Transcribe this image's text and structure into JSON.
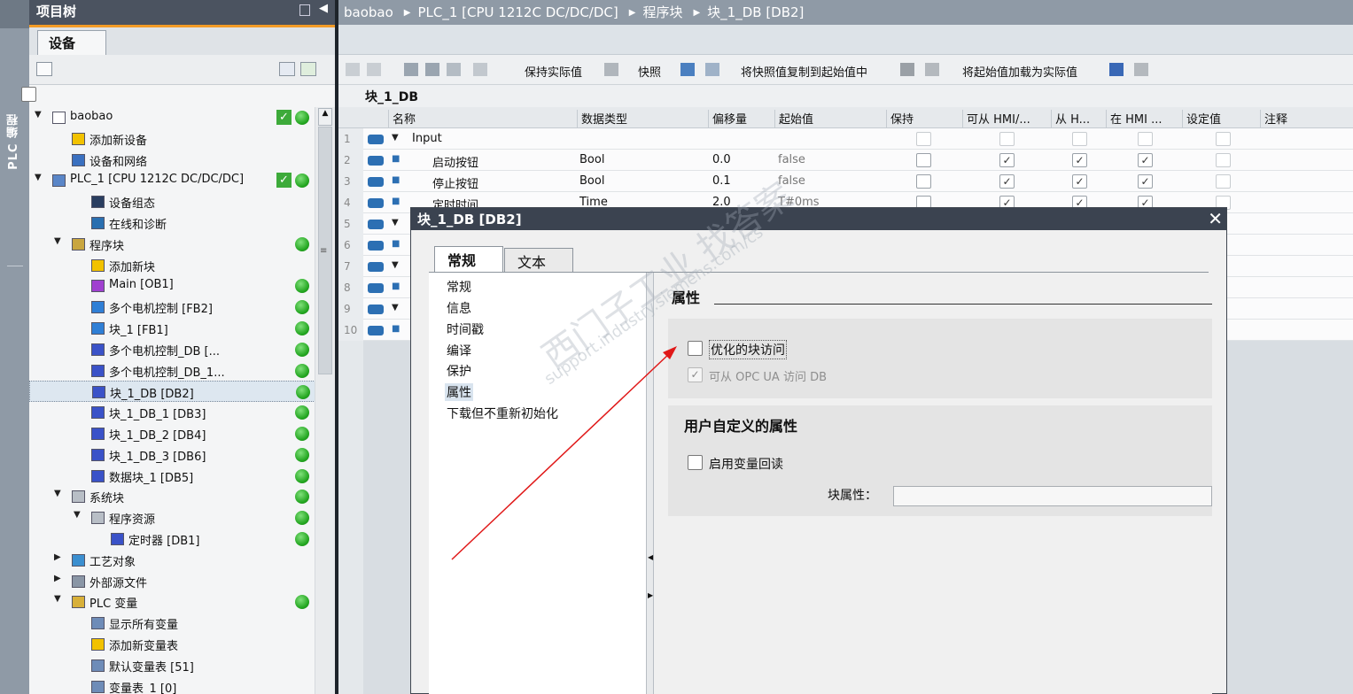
{
  "left_strip": {
    "label": "PLC 编程"
  },
  "project_tree": {
    "title": "项目树",
    "tab": "设备",
    "items": [
      {
        "label": "baobao",
        "status": "ok+online"
      },
      {
        "label": "添加新设备"
      },
      {
        "label": "设备和网络"
      },
      {
        "label": "PLC_1 [CPU 1212C DC/DC/DC]",
        "status": "ok+online"
      },
      {
        "label": "设备组态"
      },
      {
        "label": "在线和诊断"
      },
      {
        "label": "程序块",
        "status": "online"
      },
      {
        "label": "添加新块"
      },
      {
        "label": "Main [OB1]",
        "status": "online"
      },
      {
        "label": "多个电机控制 [FB2]",
        "status": "online"
      },
      {
        "label": "块_1 [FB1]",
        "status": "online"
      },
      {
        "label": "多个电机控制_DB [...",
        "status": "online"
      },
      {
        "label": "多个电机控制_DB_1...",
        "status": "online"
      },
      {
        "label": "块_1_DB [DB2]",
        "status": "online",
        "selected": true
      },
      {
        "label": "块_1_DB_1 [DB3]",
        "status": "online"
      },
      {
        "label": "块_1_DB_2 [DB4]",
        "status": "online"
      },
      {
        "label": "块_1_DB_3 [DB6]",
        "status": "online"
      },
      {
        "label": "数据块_1 [DB5]",
        "status": "online"
      },
      {
        "label": "系统块",
        "status": "online"
      },
      {
        "label": "程序资源",
        "status": "online"
      },
      {
        "label": "定时器 [DB1]",
        "status": "online"
      },
      {
        "label": "工艺对象"
      },
      {
        "label": "外部源文件"
      },
      {
        "label": "PLC 变量",
        "status": "online"
      },
      {
        "label": "显示所有变量"
      },
      {
        "label": "添加新变量表"
      },
      {
        "label": "默认变量表 [51]"
      },
      {
        "label": "变量表_1 [0]"
      }
    ]
  },
  "breadcrumb": [
    "baobao",
    "PLC_1 [CPU 1212C DC/DC/DC]",
    "程序块",
    "块_1_DB [DB2]"
  ],
  "toolbar": {
    "keep_actual": "保持实际值",
    "snapshot": "快照",
    "copy_snapshot": "将快照值复制到起始值中",
    "load_start": "将起始值加载为实际值"
  },
  "db_title": "块_1_DB",
  "table": {
    "headers": [
      "名称",
      "数据类型",
      "偏移量",
      "起始值",
      "保持",
      "可从 HMI/...",
      "从 H...",
      "在 HMI ...",
      "设定值",
      "注释"
    ],
    "rows": [
      {
        "num": "1",
        "name": "Input",
        "type": "",
        "offset": "",
        "start": "",
        "expand": "▼",
        "checks": [
          false,
          false,
          false,
          false,
          false
        ]
      },
      {
        "num": "2",
        "name": "启动按钮",
        "type": "Bool",
        "offset": "0.0",
        "start": "false",
        "expand": "■",
        "checks": [
          false,
          true,
          true,
          true,
          false
        ]
      },
      {
        "num": "3",
        "name": "停止按钮",
        "type": "Bool",
        "offset": "0.1",
        "start": "false",
        "expand": "■",
        "checks": [
          false,
          true,
          true,
          true,
          false
        ]
      },
      {
        "num": "4",
        "name": "定时时间",
        "type": "Time",
        "offset": "2.0",
        "start": "T#0ms",
        "expand": "■",
        "checks": [
          false,
          true,
          true,
          true,
          false
        ]
      },
      {
        "num": "5",
        "name": "",
        "type": "",
        "offset": "",
        "start": "",
        "expand": "▼",
        "checks": []
      },
      {
        "num": "6",
        "name": "",
        "type": "",
        "offset": "",
        "start": "",
        "expand": "■",
        "checks": []
      },
      {
        "num": "7",
        "name": "",
        "type": "",
        "offset": "",
        "start": "",
        "expand": "▼",
        "checks": []
      },
      {
        "num": "8",
        "name": "",
        "type": "",
        "offset": "",
        "start": "",
        "expand": "■",
        "checks": []
      },
      {
        "num": "9",
        "name": "",
        "type": "",
        "offset": "",
        "start": "",
        "expand": "▼",
        "checks": []
      },
      {
        "num": "10",
        "name": "",
        "type": "",
        "offset": "",
        "start": "",
        "expand": "■",
        "checks": []
      }
    ]
  },
  "dialog": {
    "title": "块_1_DB [DB2]",
    "close": "✕",
    "tabs": [
      "常规",
      "文本"
    ],
    "nav": [
      "常规",
      "信息",
      "时间戳",
      "编译",
      "保护",
      "属性",
      "下载但不重新初始化"
    ],
    "section_title": "属性",
    "optimized": {
      "label": "优化的块访问",
      "checked": false
    },
    "opcua": {
      "label": "可从 OPC UA 访问 DB",
      "checked": true
    },
    "user_section": "用户自定义的属性",
    "readback": {
      "label": "启用变量回读",
      "checked": false
    },
    "block_attr_label": "块属性："
  },
  "watermark": {
    "main": "西门子工业 找答案",
    "sub": "support.industry.siemens.com/cs"
  },
  "colors": {
    "accent_orange": "#f39b26",
    "status_green": "#3daa3a",
    "title_dark": "#4b5360",
    "arrow_red": "#e01818"
  }
}
